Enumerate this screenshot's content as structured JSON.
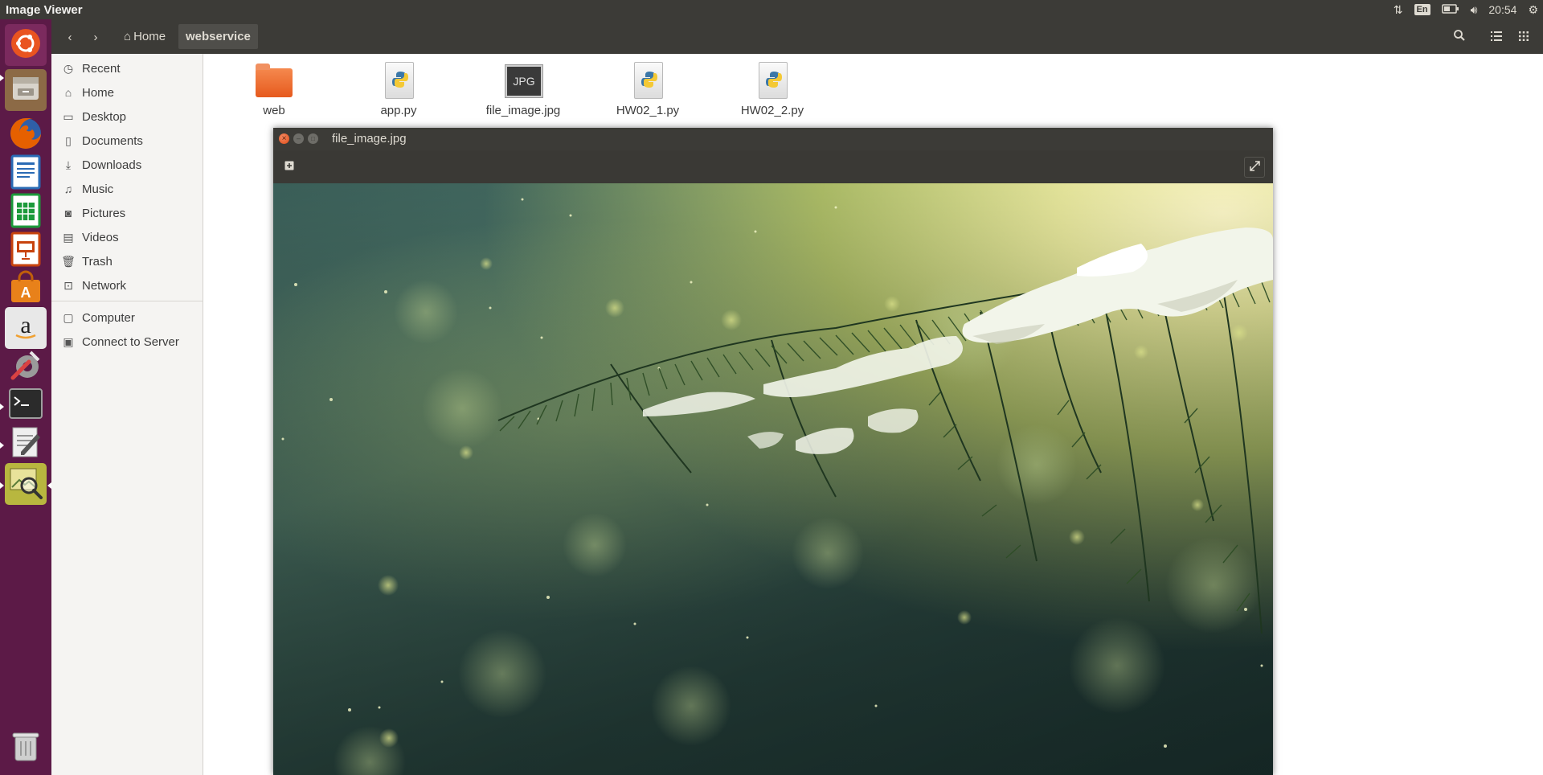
{
  "topbar": {
    "window_title": "Image Viewer",
    "keyboard_layout": "En",
    "clock": "20:54"
  },
  "launcher": {
    "apps": [
      {
        "name": "ubuntu-dash",
        "color": "#e95420"
      },
      {
        "name": "files",
        "color": "#a37e53"
      },
      {
        "name": "firefox",
        "color": "#e66000"
      },
      {
        "name": "libreoffice-writer",
        "color": "#2a6bb5"
      },
      {
        "name": "libreoffice-calc",
        "color": "#1c9a3b"
      },
      {
        "name": "libreoffice-impress",
        "color": "#c7430e"
      },
      {
        "name": "software-center",
        "color": "#e8811a"
      },
      {
        "name": "amazon",
        "color": "#ffffff"
      },
      {
        "name": "system-settings",
        "color": "#7a7a7a"
      },
      {
        "name": "terminal",
        "color": "#2b2b2b"
      },
      {
        "name": "text-editor",
        "color": "#dedede"
      },
      {
        "name": "image-viewer",
        "color": "#a9a93a"
      },
      {
        "name": "trash",
        "color": "#cfcfcf"
      }
    ]
  },
  "toolbar": {
    "breadcrumb_home": "Home",
    "breadcrumb_current": "webservice"
  },
  "sidebar": {
    "places": [
      {
        "label": "Recent",
        "icon": "clock-icon"
      },
      {
        "label": "Home",
        "icon": "home-icon"
      },
      {
        "label": "Desktop",
        "icon": "folder-icon"
      },
      {
        "label": "Documents",
        "icon": "document-icon"
      },
      {
        "label": "Downloads",
        "icon": "download-icon"
      },
      {
        "label": "Music",
        "icon": "music-icon"
      },
      {
        "label": "Pictures",
        "icon": "camera-icon"
      },
      {
        "label": "Videos",
        "icon": "film-icon"
      },
      {
        "label": "Trash",
        "icon": "trash-icon"
      },
      {
        "label": "Network",
        "icon": "network-icon"
      }
    ],
    "devices": [
      {
        "label": "Computer",
        "icon": "computer-icon"
      },
      {
        "label": "Connect to Server",
        "icon": "server-icon"
      }
    ]
  },
  "files": [
    {
      "name": "web",
      "type": "folder"
    },
    {
      "name": "app.py",
      "type": "python"
    },
    {
      "name": "file_image.jpg",
      "type": "jpg",
      "badge": "JPG"
    },
    {
      "name": "HW02_1.py",
      "type": "python"
    },
    {
      "name": "HW02_2.py",
      "type": "python"
    }
  ],
  "viewer": {
    "title": "file_image.jpg",
    "image_subject": "snow-covered pine branch with bokeh background"
  }
}
